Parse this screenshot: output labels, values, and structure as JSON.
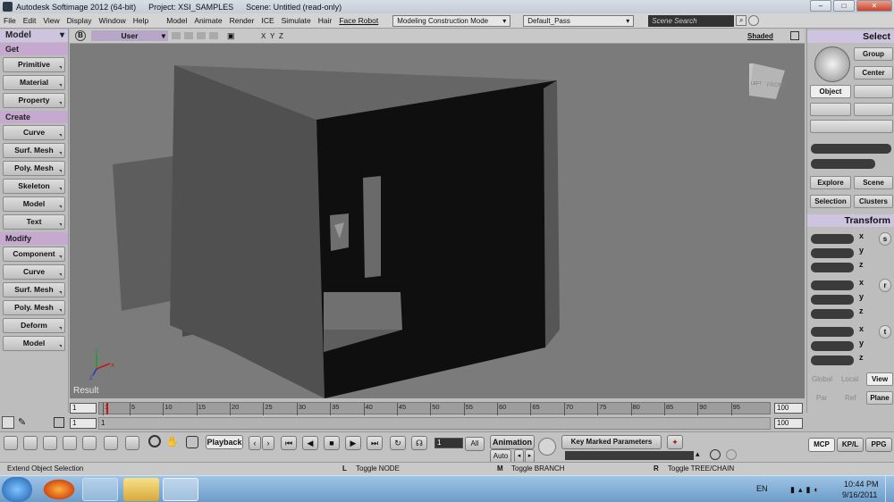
{
  "titlebar": {
    "app": "Autodesk Softimage 2012 (64-bit)",
    "project": "Project: XSI_SAMPLES",
    "scene": "Scene: Untitled (read-only)"
  },
  "menu": [
    "File",
    "Edit",
    "View",
    "Display",
    "Window",
    "Help",
    "Model",
    "Animate",
    "Render",
    "ICE",
    "Simulate",
    "Hair",
    "Face Robot"
  ],
  "mode_combo": "Modeling Construction Mode",
  "pass_combo": "Default_Pass",
  "search_placeholder": "Scene Search",
  "left": {
    "module": "Model",
    "get_head": "Get",
    "get": [
      "Primitive",
      "Material",
      "Property"
    ],
    "create_head": "Create",
    "create": [
      "Curve",
      "Surf. Mesh",
      "Poly. Mesh",
      "Skeleton",
      "Model",
      "Text"
    ],
    "modify_head": "Modify",
    "modify": [
      "Component",
      "Curve",
      "Surf. Mesh",
      "Poly. Mesh",
      "Deform",
      "Model"
    ]
  },
  "viewport": {
    "camera": "User",
    "b_label": "B",
    "axes": [
      "X",
      "Y",
      "Z"
    ],
    "display_mode": "Shaded",
    "result_label": "Result",
    "cube_labels": [
      "LEFT",
      "FRONT"
    ]
  },
  "right": {
    "select_head": "Select",
    "group": "Group",
    "center": "Center",
    "object": "Object",
    "explore": "Explore",
    "scene": "Scene",
    "selection": "Selection",
    "clusters": "Clusters",
    "transform_head": "Transform",
    "axes": [
      "x",
      "y",
      "z"
    ],
    "transform_icons": [
      "s",
      "r",
      "t"
    ],
    "global": "Global",
    "local": "Local",
    "view": "View",
    "par": "Par",
    "ref": "Ref",
    "plane": "Plane",
    "tabs": [
      "MCP",
      "KP/L",
      "PPG"
    ]
  },
  "timeline": {
    "start": "1",
    "end": "100",
    "range_start": "1",
    "range_end": "100",
    "range_mid": "1",
    "ticks": [
      "1",
      "5",
      "10",
      "15",
      "20",
      "25",
      "30",
      "35",
      "40",
      "45",
      "50",
      "55",
      "60",
      "65",
      "70",
      "75",
      "80",
      "85",
      "90",
      "95"
    ]
  },
  "playback": {
    "label": "Playback",
    "frame": "1",
    "all": "All",
    "animation": "Animation",
    "auto": "Auto",
    "key_marked": "Key Marked Parameters"
  },
  "status": {
    "message": "Extend Object Selection",
    "l": "L",
    "l_text": "Toggle NODE",
    "m": "M",
    "m_text": "Toggle BRANCH",
    "r": "R",
    "r_text": "Toggle TREE/CHAIN"
  },
  "taskbar": {
    "lang": "EN",
    "time": "10:44 PM",
    "date": "9/16/2011"
  }
}
